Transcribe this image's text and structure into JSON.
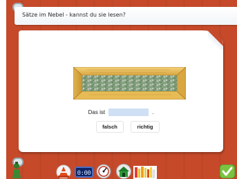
{
  "title": "Sätze im Nebel - kannst du sie lesen?",
  "sentence": {
    "prefix": "Das ist",
    "suffix": ".",
    "input_value": ""
  },
  "buttons": {
    "falsch": "falsch",
    "richtig": "richtig"
  },
  "toolbar": {
    "clock": "0:00",
    "icons": [
      "home-icon",
      "traffic-cone-icon",
      "clock-icon",
      "speedometer-icon",
      "dog-house-icon",
      "bookshelf-icon",
      "checkmark-icon"
    ]
  },
  "colors": {
    "background": "#c64a2a",
    "paper": "#ffffff",
    "input": "#cfe0f4",
    "box_wood": "#e8c15c",
    "checkmark": "#7cc242"
  }
}
